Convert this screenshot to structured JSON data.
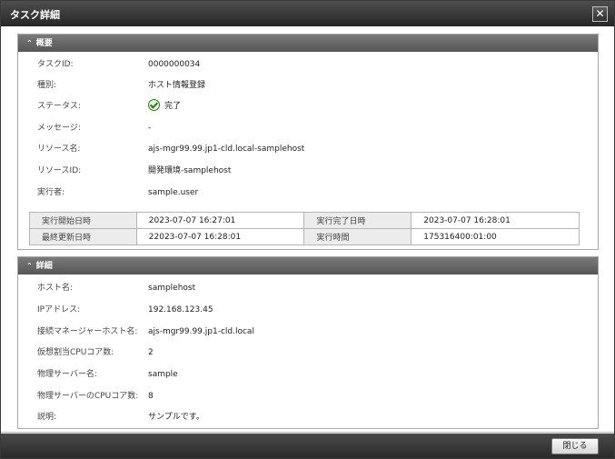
{
  "window": {
    "title": "タスク詳細",
    "close_glyph": "✕"
  },
  "overview": {
    "header": "概要",
    "rows": [
      {
        "label": "タスクID:",
        "value": "0000000034"
      },
      {
        "label": "種別:",
        "value": "ホスト情報登録"
      },
      {
        "label": "ステータス:",
        "value": "完了"
      },
      {
        "label": "メッセージ:",
        "value": "-"
      },
      {
        "label": "リソース名:",
        "value": "ajs-mgr99.99.jp1-cld.local-samplehost"
      },
      {
        "label": "リソースID:",
        "value": "開発環境-samplehost"
      },
      {
        "label": "実行者:",
        "value": "sample.user"
      }
    ],
    "times": [
      [
        {
          "label": "実行開始日時",
          "value": "2023-07-07 16:27:01"
        },
        {
          "label": "実行完了日時",
          "value": "2023-07-07 16:28:01"
        }
      ],
      [
        {
          "label": "最終更新日時",
          "value": "22023-07-07 16:28:01"
        },
        {
          "label": "実行時間",
          "value": "175316400:01:00"
        }
      ]
    ],
    "status_color": "#2e7d1f"
  },
  "details": {
    "header": "詳細",
    "rows": [
      {
        "label": "ホスト名:",
        "value": "samplehost"
      },
      {
        "label": "IPアドレス:",
        "value": "192.168.123.45"
      },
      {
        "label": "接続マネージャーホスト名:",
        "value": "ajs-mgr99.99.jp1-cld.local"
      },
      {
        "label": "仮想割当CPUコア数:",
        "value": "2"
      },
      {
        "label": "物理サーバー名:",
        "value": "sample"
      },
      {
        "label": "物理サーバーのCPUコア数:",
        "value": "8"
      },
      {
        "label": "説明:",
        "value": "サンプルです。"
      }
    ]
  },
  "footer": {
    "close_label": "閉じる"
  }
}
